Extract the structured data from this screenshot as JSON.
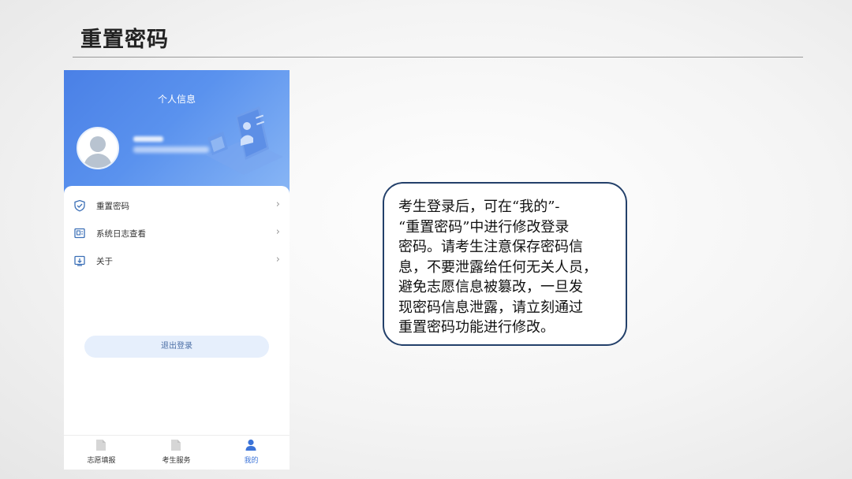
{
  "slide": {
    "title": "重置密码"
  },
  "phone": {
    "header_title": "个人信息",
    "menu": [
      {
        "label": "重置密码",
        "icon": "shield-icon"
      },
      {
        "label": "系统日志查看",
        "icon": "log-icon"
      },
      {
        "label": "关于",
        "icon": "info-download-icon"
      }
    ],
    "chevron": "›",
    "logout_label": "退出登录",
    "tabs": [
      {
        "label": "志愿填报",
        "icon": "document-icon",
        "active": false
      },
      {
        "label": "考生服务",
        "icon": "document-icon",
        "active": false
      },
      {
        "label": "我的",
        "icon": "person-icon",
        "active": true
      }
    ],
    "colors": {
      "header_start": "#4a80e6",
      "header_end": "#8ab7f5",
      "accent": "#3b73d8",
      "logout_bg": "#e6effc"
    }
  },
  "callout": {
    "text": "考生登录后，可在“我的”-\n“重置密码”中进行修改登录\n密码。请考生注意保存密码信\n息，不要泄露给任何无关人员，\n避免志愿信息被篡改，一旦发\n现密码信息泄露，请立刻通过\n重置密码功能进行修改。",
    "border_color": "#23406a"
  }
}
